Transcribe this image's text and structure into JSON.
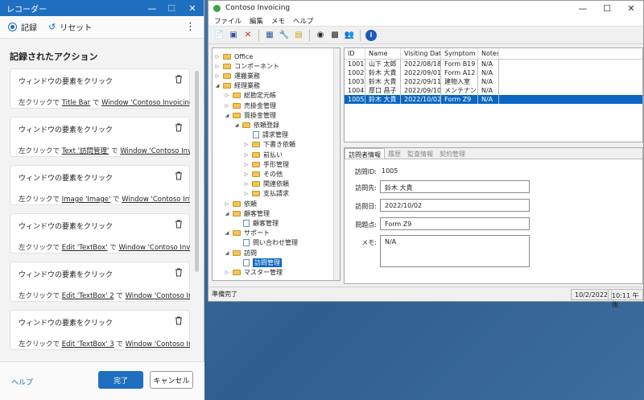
{
  "recorder": {
    "title": "レコーダー",
    "record_label": "記録",
    "reset_label": "リセット",
    "heading": "記録されたアクション",
    "actions": [
      {
        "title": "ウィンドウの要素をクリック",
        "prefix": "左クリックで",
        "target": "Title Bar",
        "mid": "で",
        "window": "Window 'Contoso Invoicing'"
      },
      {
        "title": "ウィンドウの要素をクリック",
        "prefix": "左クリックで",
        "target": "Text '訪問管理'",
        "mid": "で",
        "window": "Window 'Contoso Invoicing'"
      },
      {
        "title": "ウィンドウの要素をクリック",
        "prefix": "左クリックで",
        "target": "Image 'Image'",
        "mid": "で",
        "window": "Window 'Contoso Invoicing'"
      },
      {
        "title": "ウィンドウの要素をクリック",
        "prefix": "左クリックで",
        "target": "Edit 'TextBox'",
        "mid": "で",
        "window": "Window 'Contoso Invoicing'"
      },
      {
        "title": "ウィンドウの要素をクリック",
        "prefix": "左クリックで",
        "target": "Edit 'TextBox' 2",
        "mid": "で",
        "window": "Window 'Contoso Invoicing'"
      },
      {
        "title": "ウィンドウの要素をクリック",
        "prefix": "左クリックで",
        "target": "Edit 'TextBox' 3",
        "mid": "で",
        "window": "Window 'Contoso Invoicing'"
      }
    ],
    "help_label": "ヘルプ",
    "done_label": "完了",
    "cancel_label": "キャンセル"
  },
  "app": {
    "title": "Contoso Invoicing",
    "menu": [
      "ファイル",
      "編集",
      "メモ",
      "ヘルプ"
    ],
    "tree": [
      {
        "label": "Office",
        "kind": "folder",
        "depth": 0,
        "exp": "▷"
      },
      {
        "label": "コンポーネント",
        "kind": "folder",
        "depth": 0,
        "exp": "▷"
      },
      {
        "label": "運搬業務",
        "kind": "folder",
        "depth": 0,
        "exp": "▷"
      },
      {
        "label": "経理業務",
        "kind": "folder",
        "depth": 0,
        "exp": "◢"
      },
      {
        "label": "総勘定元帳",
        "kind": "folder",
        "depth": 1,
        "exp": "▷"
      },
      {
        "label": "売掛金管理",
        "kind": "folder",
        "depth": 1,
        "exp": "▷"
      },
      {
        "label": "買掛金管理",
        "kind": "folder",
        "depth": 1,
        "exp": "◢"
      },
      {
        "label": "依頼登録",
        "kind": "folder",
        "depth": 2,
        "exp": "◢"
      },
      {
        "label": "請求管理",
        "kind": "doc",
        "depth": 3,
        "exp": ""
      },
      {
        "label": "下書き依頼",
        "kind": "folder",
        "depth": 3,
        "exp": "▷"
      },
      {
        "label": "前払い",
        "kind": "folder",
        "depth": 3,
        "exp": "▷"
      },
      {
        "label": "手形管理",
        "kind": "folder",
        "depth": 3,
        "exp": "▷"
      },
      {
        "label": "その他",
        "kind": "folder",
        "depth": 3,
        "exp": "▷"
      },
      {
        "label": "関連依頼",
        "kind": "folder",
        "depth": 3,
        "exp": "▷"
      },
      {
        "label": "支払請求",
        "kind": "folder",
        "depth": 3,
        "exp": "▷"
      },
      {
        "label": "依頼",
        "kind": "folder",
        "depth": 1,
        "exp": "▷"
      },
      {
        "label": "顧客管理",
        "kind": "folder",
        "depth": 1,
        "exp": "◢"
      },
      {
        "label": "顧客管理",
        "kind": "doc",
        "depth": 2,
        "exp": ""
      },
      {
        "label": "サポート",
        "kind": "folder",
        "depth": 1,
        "exp": "◢"
      },
      {
        "label": "問い合わせ管理",
        "kind": "doc",
        "depth": 2,
        "exp": ""
      },
      {
        "label": "訪問",
        "kind": "folder",
        "depth": 1,
        "exp": "◢"
      },
      {
        "label": "訪問管理",
        "kind": "doc",
        "depth": 2,
        "exp": "",
        "selected": true
      },
      {
        "label": "マスター管理",
        "kind": "folder",
        "depth": 1,
        "exp": "▷"
      }
    ],
    "grid": {
      "headers": [
        "ID",
        "Name",
        "Visiting Date",
        "Symptom",
        "Notes"
      ],
      "rows": [
        [
          "1001",
          "山下 太郎",
          "2022/08/18",
          "Form B19",
          "N/A"
        ],
        [
          "1002",
          "鈴木 大貴",
          "2022/09/01",
          "Form A12",
          "N/A"
        ],
        [
          "1003",
          "鈴木 大貴",
          "2022/09/11",
          "建物入室",
          "N/A"
        ],
        [
          "1004",
          "厚口 昌子",
          "2022/09/10",
          "メンテナンス",
          "N/A"
        ],
        [
          "1005",
          "鈴木 大貴",
          "2022/10/02",
          "Form Z9",
          "N/A"
        ]
      ],
      "selected_row": 4
    },
    "tabs": [
      "訪問者情報",
      "履歴",
      "監査情報",
      "契約管理"
    ],
    "detail": {
      "id_label": "訪問ID:",
      "id_value": "1005",
      "dest_label": "訪問先:",
      "dest_value": "鈴木 大貴",
      "date_label": "訪問日:",
      "date_value": "2022/10/02",
      "issue_label": "問題点:",
      "issue_value": "Form Z9",
      "memo_label": "メモ:",
      "memo_value": "N/A"
    },
    "status": {
      "text": "準備完了",
      "date": "10/2/2022",
      "time": "10:11 午後"
    }
  }
}
